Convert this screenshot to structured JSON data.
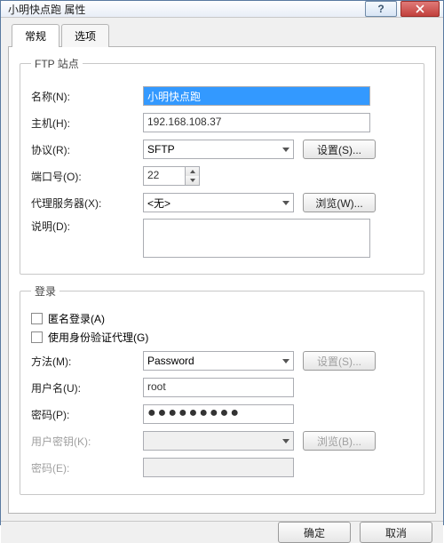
{
  "window": {
    "title": "小明快点跑 属性"
  },
  "tabs": {
    "general": "常规",
    "options": "选项"
  },
  "ftp": {
    "legend": "FTP 站点",
    "name_label": "名称(N):",
    "name_value": "小明快点跑",
    "host_label": "主机(H):",
    "host_value": "192.168.108.37",
    "protocol_label": "协议(R):",
    "protocol_value": "SFTP",
    "settings_btn": "设置(S)...",
    "port_label": "端口号(O):",
    "port_value": "22",
    "proxy_label": "代理服务器(X):",
    "proxy_value": "<无>",
    "browse_btn": "浏览(W)...",
    "desc_label": "说明(D):"
  },
  "login": {
    "legend": "登录",
    "anon_label": "匿名登录(A)",
    "authagent_label": "使用身份验证代理(G)",
    "method_label": "方法(M):",
    "method_value": "Password",
    "settings_btn": "设置(S)...",
    "user_label": "用户名(U):",
    "user_value": "root",
    "pass_label": "密码(P):",
    "pass_value": "●●●●●●●●●",
    "userkey_label": "用户密钥(K):",
    "browse_btn": "浏览(B)...",
    "passphrase_label": "密码(E):"
  },
  "footer": {
    "ok": "确定",
    "cancel": "取消"
  }
}
